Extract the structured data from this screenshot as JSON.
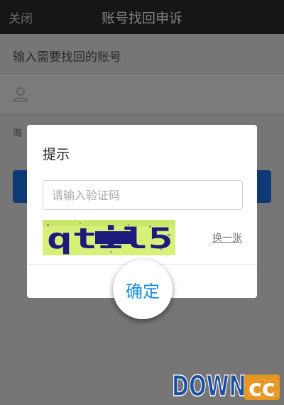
{
  "navbar": {
    "close_label": "关闭",
    "title": "账号找回申诉"
  },
  "page": {
    "section_label": "输入需要找回的账号",
    "hint_text": "海",
    "account_icon": "user-icon"
  },
  "dialog": {
    "title": "提示",
    "captcha_placeholder": "请输入验证码",
    "captcha_value": "",
    "captcha_image_text": "qtil5",
    "refresh_label": "换一张",
    "confirm_label": "确定"
  },
  "watermark": {
    "text": "DOWN.cc"
  },
  "colors": {
    "navbar_bg": "#2d2d2d",
    "accent_blue": "#1a8fe0",
    "primary_button": "#1a73e8",
    "captcha_bg": "#d6f07a",
    "captcha_text": "#1c1a7a"
  }
}
